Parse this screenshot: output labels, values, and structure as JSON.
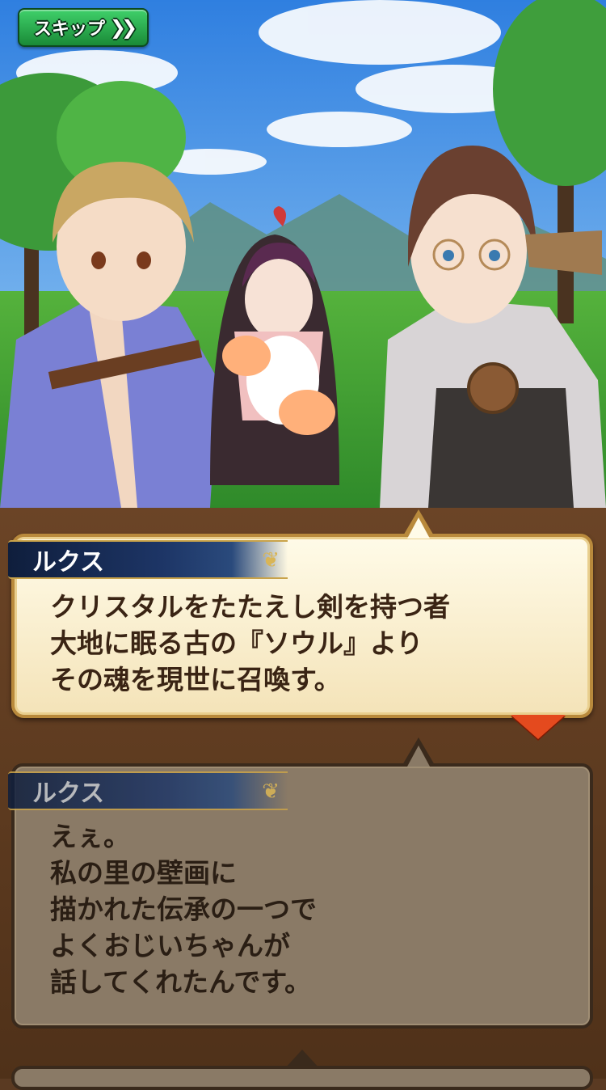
{
  "skip_button": {
    "label": "スキップ",
    "icon": "double-chevron-right-icon",
    "glyph": "❯❯"
  },
  "current_message": {
    "speaker": "ルクス",
    "lines": [
      "クリスタルをたたえし剣を持つ者",
      "大地に眠る古の『ソウル』より",
      "その魂を現世に召喚す。"
    ]
  },
  "previous_message": {
    "speaker": "ルクス",
    "lines": [
      "えぇ。",
      "私の里の壁画に",
      "描かれた伝承の一つで",
      "よくおじいちゃんが",
      "話してくれたんです。"
    ]
  },
  "colors": {
    "skip_green": "#1a8a37",
    "name_plate": "#1d3566",
    "advance_arrow": "#e44a1e",
    "bubble_active": "#fffbe8"
  }
}
